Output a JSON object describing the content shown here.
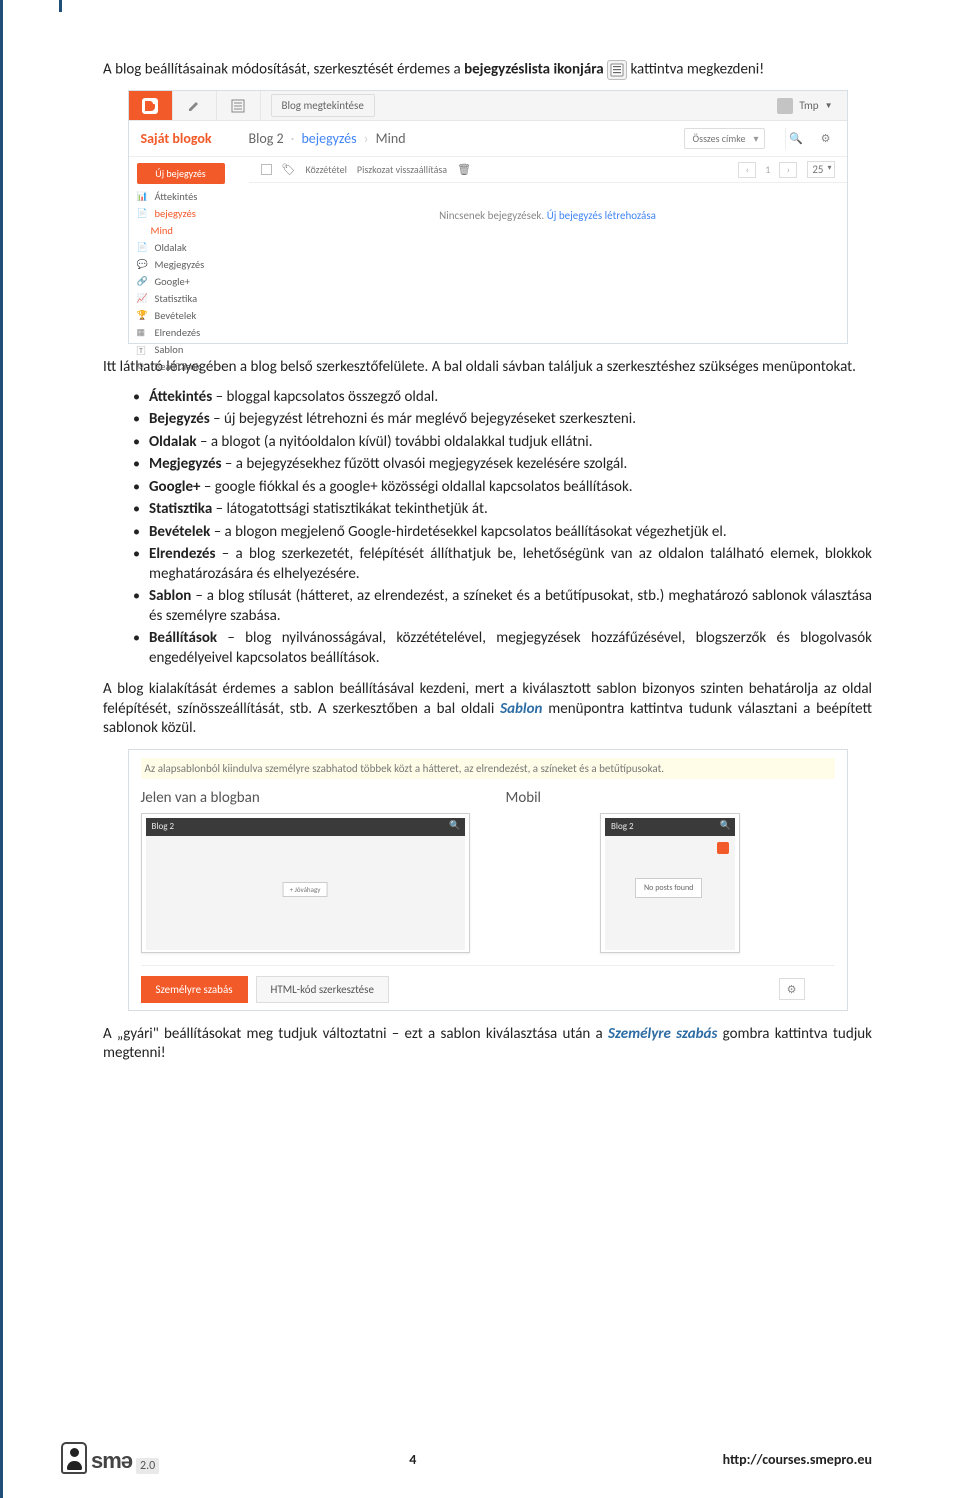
{
  "para1_pre": "A blog beállításainak módosítását, szerkesztését érdemes a ",
  "para1_bold": "bejegyzéslista ikonjára",
  "para1_post": " kattintva megkezdeni!",
  "shot1": {
    "top": {
      "view_blog": "Blog megtekintése",
      "user": "Tmp",
      "user_arrow": "▼"
    },
    "my_blogs": "Saját blogok",
    "title_blog": "Blog 2",
    "title_sep1": "·",
    "title_posts": "bejegyzés",
    "title_sep2": "›",
    "title_all": "Mind",
    "all_labels": "Összes címke",
    "new_post": "Új bejegyzés",
    "sidebar": [
      {
        "label": "Áttekintés",
        "active": false
      },
      {
        "label": "bejegyzés",
        "active": true,
        "sub": false
      },
      {
        "label": "Mind",
        "active": true,
        "sub": true
      },
      {
        "label": "Oldalak",
        "active": false
      },
      {
        "label": "Megjegyzés",
        "active": false
      },
      {
        "label": "Google+",
        "active": false
      },
      {
        "label": "Statisztika",
        "active": false
      },
      {
        "label": "Bevételek",
        "active": false
      },
      {
        "label": "Elrendezés",
        "active": false
      },
      {
        "label": "Sablon",
        "active": false
      },
      {
        "label": "Beállítások",
        "active": false
      }
    ],
    "toolbar": {
      "publish": "Közzététel",
      "revert": "Piszkozat visszaállítása",
      "page": "1",
      "per": "25"
    },
    "empty_pre": "Nincsenek bejegyzések. ",
    "empty_link": "Új bejegyzés létrehozása"
  },
  "para2": "Itt látható lényegében a blog belső szerkesztőfelülete. A bal oldali sávban találjuk a szerkesztéshez szükséges menüpontokat.",
  "bullets": [
    {
      "b": "Áttekintés",
      "t": " – bloggal kapcsolatos összegző oldal."
    },
    {
      "b": "Bejegyzés",
      "t": " – új bejegyzést létrehozni és már meglévő bejegyzéseket szerkeszteni."
    },
    {
      "b": "Oldalak",
      "t": " – a blogot (a nyitóoldalon kívül) további oldalakkal tudjuk ellátni."
    },
    {
      "b": "Megjegyzés",
      "t": " – a bejegyzésekhez fűzött olvasói megjegyzések kezelésére szolgál."
    },
    {
      "b": "Google+",
      "t": " – google fiókkal és a google+ közösségi oldallal kapcsolatos beállítások."
    },
    {
      "b": "Statisztika",
      "t": " – látogatottsági statisztikákat tekinthetjük át."
    },
    {
      "b": "Bevételek",
      "t": " – a blogon megjelenő Google-hirdetésekkel kapcsolatos beállításokat végezhetjük el."
    },
    {
      "b": "Elrendezés",
      "t": " – a blog szerkezetét, felépítését állíthatjuk be, lehetőségünk van az oldalon található elemek, blokkok meghatározására és elhelyezésére."
    },
    {
      "b": "Sablon",
      "t": " – a blog stílusát (hátteret, az elrendezést, a színeket és a betűtípusokat, stb.) meghatározó sablonok választása és személyre szabása."
    },
    {
      "b": "Beállítások",
      "t": " – blog nyilvánosságával, közzétételével, megjegyzések hozzáfűzésével, blogszerzők és blogolvasók engedélyeivel kapcsolatos beállítások."
    }
  ],
  "para3_a": "A blog kialakítását érdemes a sablon beállításával kezdeni, mert a kiválasztott sablon bizonyos szinten behatárolja az oldal felépítését, színösszeállítását, stb.  A szerkesztőben a bal oldali ",
  "para3_link": "Sablon",
  "para3_b": " menüpontra kattintva tudunk választani a beépített sablonok közül.",
  "shot2": {
    "hint": "Az alapsablonból kiindulva személyre szabhatod többek közt a hátteret, az elrendezést, a színeket és a betűtípusokat.",
    "live": "Jelen van a blogban",
    "mobile": "Mobil",
    "prev_title": "Blog 2",
    "prev_btn": "+ Jóváhagy",
    "no_posts": "No posts found",
    "btn_custom": "Személyre szabás",
    "btn_html": "HTML-kód szerkesztése"
  },
  "para4_a": "A „gyári\" beállításokat meg tudjuk változtatni – ezt a sablon kiválasztása után a ",
  "para4_link": "Személyre szabás",
  "para4_b": " gombra kattintva tudjuk megtenni!",
  "footer": {
    "page": "4",
    "url": "http://courses.smepro.eu",
    "brand": "smə",
    "ver": "2.0"
  }
}
